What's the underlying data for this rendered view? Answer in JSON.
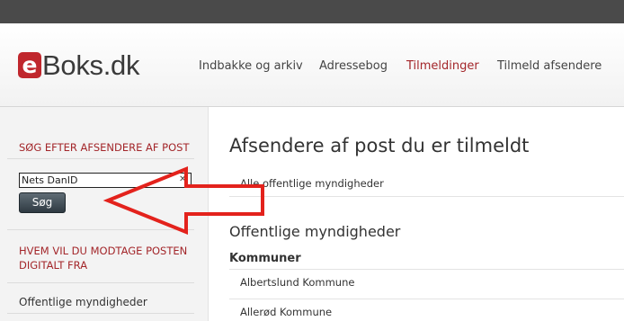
{
  "brand": {
    "logo_letter": "e",
    "logo_text": "Boks.dk",
    "accent_color": "#c0272d"
  },
  "nav": [
    {
      "label": "Indbakke og arkiv",
      "active": false
    },
    {
      "label": "Adressebog",
      "active": false
    },
    {
      "label": "Tilmeldinger",
      "active": true
    },
    {
      "label": "Tilmeld afsendere",
      "active": false
    }
  ],
  "sidebar": {
    "search_heading": "SØG EFTER AFSENDERE AF POST",
    "search_value": "Nets DanID",
    "search_button": "Søg",
    "receive_heading_line1": "HVEM VIL DU MODTAGE POSTEN",
    "receive_heading_line2": "DIGITALT FRA",
    "items": [
      "Offentlige myndigheder"
    ]
  },
  "main": {
    "title": "Afsendere af post du er tilmeldt",
    "all_link": "Alle offentlige myndigheder",
    "section_title": "Offentlige myndigheder",
    "subsection_title": "Kommuner",
    "municipalities": [
      "Albertslund Kommune",
      "Allerød Kommune"
    ]
  },
  "annotation": {
    "arrow_color": "#e3221c",
    "arrow_points_to": "search-input"
  }
}
